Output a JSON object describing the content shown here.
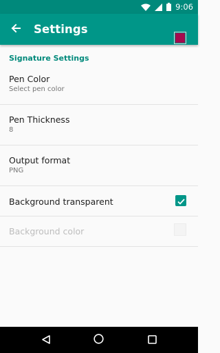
{
  "status_bar": {
    "time": "9:06",
    "icons": [
      "wifi-icon",
      "signal-icon",
      "battery-icon"
    ]
  },
  "app_bar": {
    "title": "Settings",
    "back_icon": "arrow-back-icon"
  },
  "section": {
    "header": "Signature Settings"
  },
  "prefs": {
    "pen_color": {
      "title": "Pen Color",
      "summary": "Select pen color",
      "color": "#a50a4d"
    },
    "pen_thickness": {
      "title": "Pen Thickness",
      "summary": "8"
    },
    "output_format": {
      "title": "Output format",
      "summary": "PNG"
    },
    "background_transparent": {
      "title": "Background transparent",
      "checked": true
    },
    "background_color": {
      "title": "Background color",
      "enabled": false
    }
  },
  "colors": {
    "status_bar": "#00897b",
    "app_bar": "#009688",
    "accent": "#009688"
  },
  "nav_bar": {
    "icons": [
      "back-triangle-icon",
      "home-circle-icon",
      "recents-square-icon"
    ]
  }
}
